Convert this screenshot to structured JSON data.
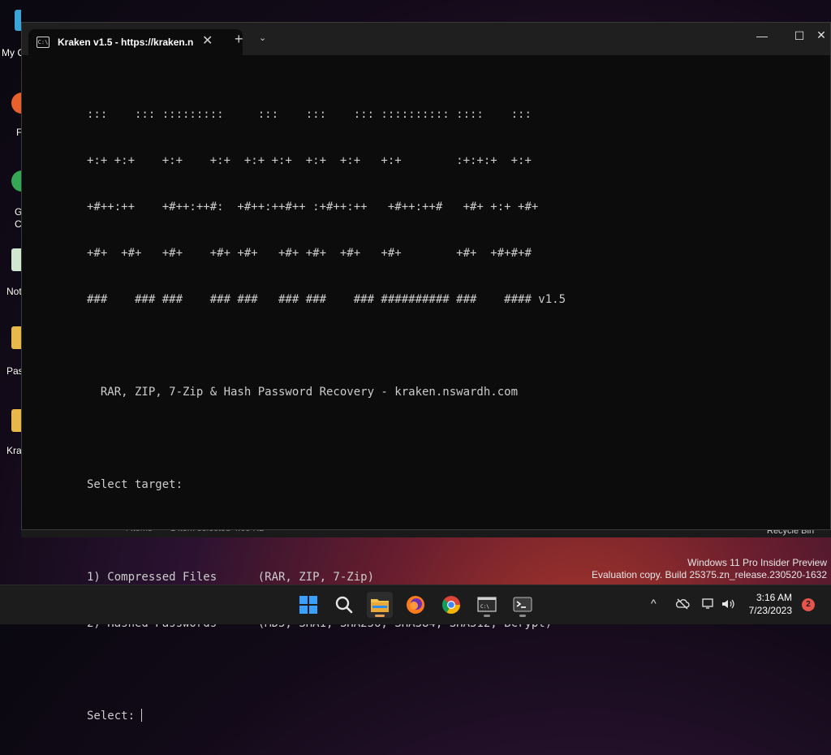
{
  "desktop": {
    "icons": [
      {
        "label": "My C",
        "icon": "this-pc-icon"
      },
      {
        "label": "F",
        "icon": "firefox-shortcut-icon"
      },
      {
        "label": "G",
        "icon": "chrome-shortcut-icon",
        "label2": "C"
      },
      {
        "label": "Not",
        "icon": "notepad-shortcut-icon"
      },
      {
        "label": "Pas",
        "icon": "folder-shortcut-icon"
      },
      {
        "label": "Kra",
        "icon": "folder-icon"
      }
    ],
    "background_window": {
      "items_text": "4 items",
      "selected_text": "1 item selected  4.65 KB"
    },
    "recycle_bin_label": "Recycle Bin",
    "watermark": {
      "line1": "Windows 11 Pro Insider Preview",
      "line2": "Evaluation copy. Build 25375.zn_release.230520-1632"
    }
  },
  "terminal": {
    "tab_title": "Kraken v1.5 - https://kraken.n",
    "new_tab_symbol": "+",
    "dropdown_symbol": "⌄",
    "close_symbol": "✕",
    "minimize_symbol": "—",
    "maximize_symbol": "☐",
    "window_close_symbol": "✕",
    "output": {
      "banner": [
        ":::    ::: :::::::::     :::    :::    ::: :::::::::: ::::    :::",
        "+:+ +:+    +:+    +:+  +:+ +:+  +:+  +:+   +:+        :+:+:+  +:+",
        "+#++:++    +#++:++#:  +#++:++#++ :+#++:++   +#++:++#   +#+ +:+ +#+",
        "+#+  +#+   +#+    +#+ +#+   +#+ +#+  +#+   +#+        +#+  +#+#+#",
        "###    ### ###    ### ###   ### ###    ### ########## ###    #### v1.5"
      ],
      "subtitle": "  RAR, ZIP, 7-Zip & Hash Password Recovery - kraken.nswardh.com",
      "prompt_header": "Select target:",
      "options": [
        "1) Compressed Files      (RAR, ZIP, 7-Zip)",
        "2) Hashed Passwords      (MD5, SHA1, SHA256, SHA384, SHA512, BCrypt)"
      ],
      "input_prompt": "Select: ",
      "input_value": ""
    }
  },
  "taskbar": {
    "apps": [
      {
        "name": "start-button",
        "icon": "windows-start-icon"
      },
      {
        "name": "search-button",
        "icon": "search-icon"
      },
      {
        "name": "file-explorer-button",
        "icon": "file-explorer-icon"
      },
      {
        "name": "firefox-button",
        "icon": "firefox-icon"
      },
      {
        "name": "chrome-button",
        "icon": "chrome-icon"
      },
      {
        "name": "command-prompt-button",
        "icon": "command-prompt-icon"
      },
      {
        "name": "terminal-button",
        "icon": "terminal-icon"
      }
    ],
    "tray": {
      "chevron": "^",
      "time": "3:16 AM",
      "date": "7/23/2023",
      "notification_count": "2"
    }
  },
  "colors": {
    "terminal_bg": "#0c0c0c",
    "terminal_fg": "#cccccc",
    "titlebar_bg": "#1f1f1f",
    "taskbar_bg": "#1c1c1c",
    "notification_badge": "#e5534b",
    "windows_blue": "#0a84ff"
  }
}
